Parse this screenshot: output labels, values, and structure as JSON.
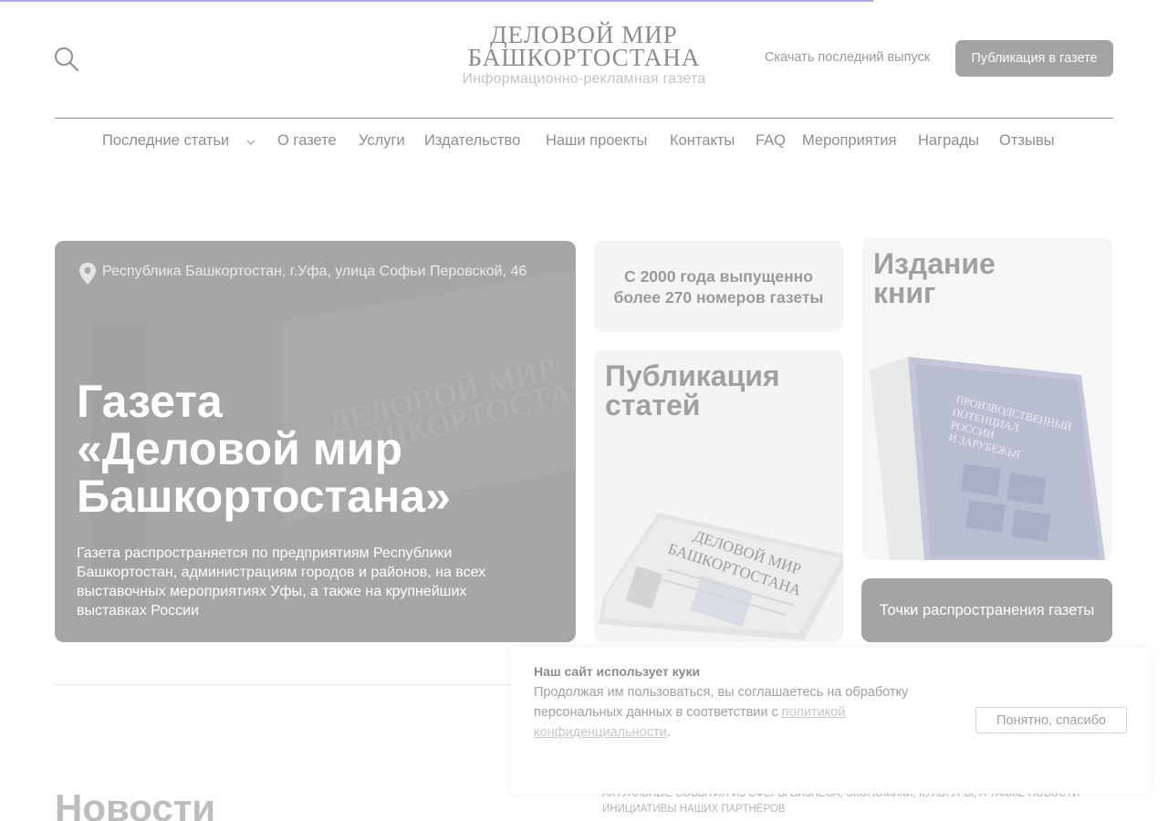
{
  "header": {
    "logo_line1": "ДЕЛОВОЙ МИР",
    "logo_line2": "БАШКОРТОСТАНА",
    "logo_subtitle": "Информационно-рекламная газета",
    "download_link": "Скачать последний выпуск",
    "publish_button": "Публикация в газете"
  },
  "nav": {
    "items": [
      {
        "label": "Последние статьи",
        "has_dropdown": true
      },
      {
        "label": "О газете"
      },
      {
        "label": "Услуги"
      },
      {
        "label": "Издательство"
      },
      {
        "label": "Наши проекты"
      },
      {
        "label": "Контакты"
      },
      {
        "label": "FAQ"
      },
      {
        "label": "Мероприятия"
      },
      {
        "label": "Награды"
      },
      {
        "label": "Отзывы"
      }
    ]
  },
  "hero": {
    "address": "Республика Башкортостан, г.Уфа, улица Софьи Перовской, 46",
    "title_line1": "Газета",
    "title_line2": "«Деловой мир",
    "title_line3": "Башкортостана»",
    "description": "Газета распространяется по предприятиям Республики Башкортостан, администрациям городов и районов, на всех выставочных мероприятиях Уфы, а также на крупнейших выставках России",
    "bg_watermark_line1": "ДЕЛОВОЙ МИР",
    "bg_watermark_line2": "БАШКОРТОСТАНА"
  },
  "cards": {
    "stat_line1": "С 2000 года выпущенно",
    "stat_line2": "более 270 номеров газеты",
    "publication_line1": "Публикация",
    "publication_line2": "статей",
    "books_line1": "Издание",
    "books_line2": "книг",
    "points_button": "Точки распространения газеты",
    "newspaper_masthead_line1": "ДЕЛОВОЙ МИР",
    "newspaper_masthead_line2": "БАШКОРТОСТАНА",
    "book_cover_line1": "ПРОИЗВОДСТВЕННЫЙ",
    "book_cover_line2": "ПОТЕНЦИАЛ",
    "book_cover_line3": "РОССИИ",
    "book_cover_line4": "И ЗАРУБЕЖЬЯ"
  },
  "news": {
    "heading": "Новости",
    "description": "Актуальные события из сферы бизнеса, экономики, культуры, а также новости инициативы наших партнёров"
  },
  "cookie": {
    "title": "Наш сайт использует куки",
    "text_before": "Продолжая им пользоваться, вы соглашаетесь на обработку персональных данных в соответствии с ",
    "link_text": "политикой конфиденциальности",
    "text_after": ".",
    "accept_button": "Понятно, спасибо"
  },
  "page": {
    "scroll_progress_fraction": 0.748
  },
  "colors": {
    "progress": "#a9a9e6",
    "hero_bg": "#a6a6a6",
    "button_bg": "#a3a3a3"
  }
}
